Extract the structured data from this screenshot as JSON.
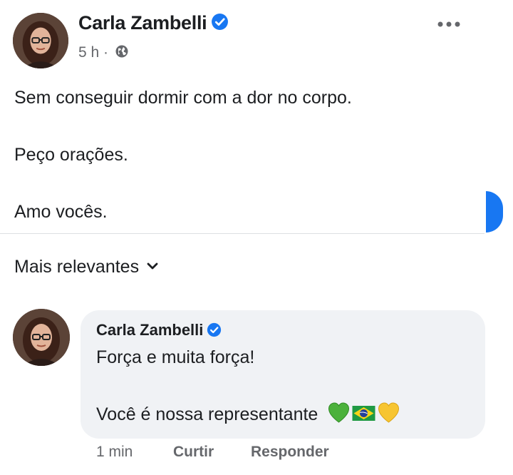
{
  "post": {
    "author": "Carla Zambelli",
    "time": "5 h",
    "separator": "·",
    "lines": [
      "Sem conseguir dormir com a dor no corpo.",
      "Peço orações.",
      "Amo vocês."
    ],
    "privacy_icon": "globe-icon",
    "verified_icon": "verified-badge-icon",
    "more_icon": "more-options-icon"
  },
  "comments_header": {
    "sort_label": "Mais relevantes",
    "sort_icon": "chevron-down-icon"
  },
  "comment": {
    "author": "Carla Zambelli",
    "line1": "Força e muita força!",
    "line2": "Você é nossa representante",
    "emojis": [
      "green-heart",
      "brazil-flag",
      "yellow-heart"
    ],
    "time": "1 min",
    "like_label": "Curtir",
    "reply_label": "Responder"
  },
  "colors": {
    "accent": "#1877f2",
    "text": "#1c1e21",
    "secondary": "#65676b",
    "bubble": "#f0f2f5",
    "divider": "#dddfe2"
  }
}
